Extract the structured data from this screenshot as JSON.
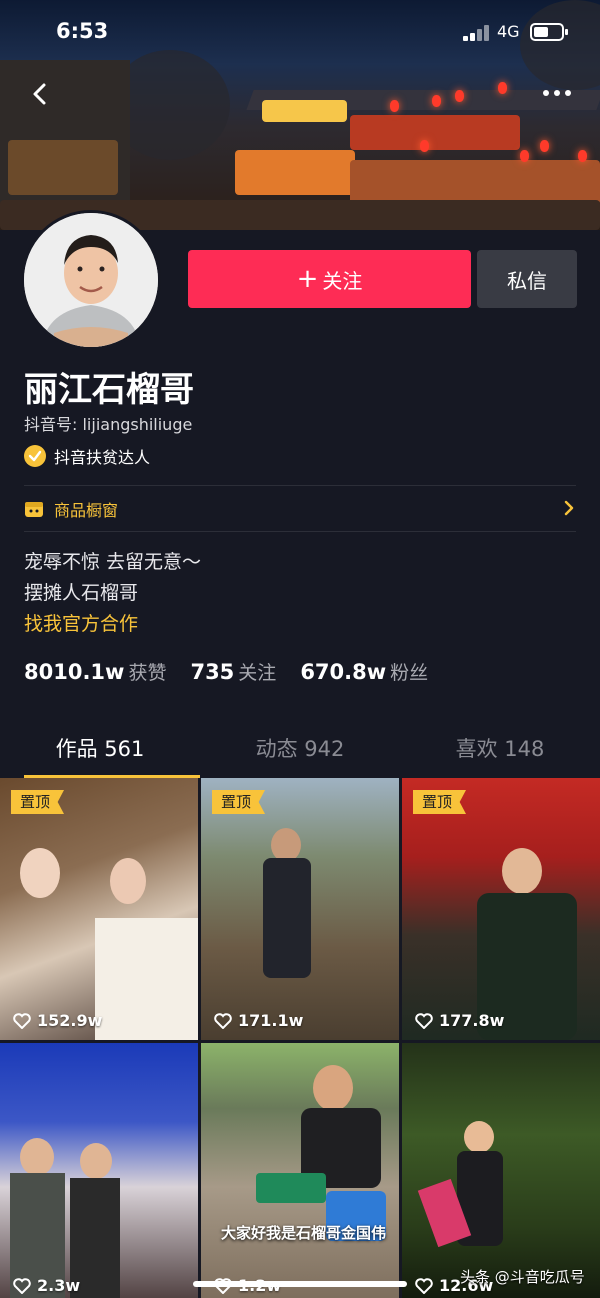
{
  "status_bar": {
    "time": "6:53",
    "network": "4G"
  },
  "profile": {
    "follow_label": "关注",
    "message_label": "私信",
    "nickname": "丽江石榴哥",
    "douyin_id": "抖音号: lijiangshiliuge",
    "badge": "抖音扶贫达人",
    "shop_label": "商品橱窗",
    "bio_lines": [
      "宠辱不惊 去留无意～",
      "摆摊人石榴哥"
    ],
    "bio_link": "找我官方合作"
  },
  "stats": [
    {
      "value": "8010.1w",
      "label": "获赞"
    },
    {
      "value": "735",
      "label": "关注"
    },
    {
      "value": "670.8w",
      "label": "粉丝"
    }
  ],
  "tabs": [
    {
      "label": "作品 561",
      "active": true
    },
    {
      "label": "动态 942",
      "active": false
    },
    {
      "label": "喜欢 148",
      "active": false
    }
  ],
  "videos": [
    {
      "pinned": "置顶",
      "likes": "152.9w"
    },
    {
      "pinned": "置顶",
      "likes": "171.1w"
    },
    {
      "pinned": "置顶",
      "likes": "177.8w"
    },
    {
      "pinned": "",
      "likes": "2.3w"
    },
    {
      "pinned": "",
      "likes": "1.2w",
      "caption": "大家好我是石榴哥金国伟"
    },
    {
      "pinned": "",
      "likes": "12.6w"
    }
  ],
  "watermark": "头条 @斗音吃瓜号",
  "colors": {
    "accent": "#fe2c55",
    "highlight": "#f8c33a",
    "background": "#161823"
  }
}
